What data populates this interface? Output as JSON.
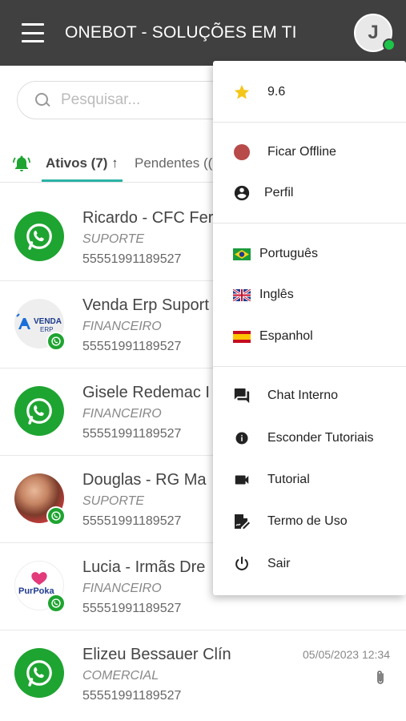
{
  "header": {
    "title": "ONEBOT - SOLUÇÕES EM TI",
    "avatar_initial": "J"
  },
  "search": {
    "placeholder": "Pesquisar..."
  },
  "tabs": {
    "active_label": "Ativos (7) ↑",
    "pending_label": "Pendentes (("
  },
  "chats": [
    {
      "name": "Ricardo - CFC Fer",
      "department": "SUPORTE",
      "phone": "55551991189527",
      "avatar": "whatsapp"
    },
    {
      "name": "Venda Erp Suport",
      "department": "FINANCEIRO",
      "phone": "55551991189527",
      "avatar": "venda-erp"
    },
    {
      "name": "Gisele Redemac I",
      "department": "FINANCEIRO",
      "phone": "55551991189527",
      "avatar": "whatsapp"
    },
    {
      "name": "Douglas - RG Ma",
      "department": "SUPORTE",
      "phone": "55551991189527",
      "avatar": "photo"
    },
    {
      "name": "Lucia - Irmãs Dre",
      "department": "FINANCEIRO",
      "phone": "55551991189527",
      "avatar": "purpoka"
    },
    {
      "name": "Elizeu Bessauer Clín",
      "department": "COMERCIAL",
      "phone": "55551991189527",
      "avatar": "whatsapp",
      "date": "05/05/2023 12:34"
    }
  ],
  "logos": {
    "venda_erp_line1": "VENDA",
    "venda_erp_line2": "ERP",
    "purpoka": "PurPoka"
  },
  "menu": {
    "rating": "9.6",
    "go_offline": "Ficar Offline",
    "profile": "Perfil",
    "lang_pt": "Português",
    "lang_en": "Inglês",
    "lang_es": "Espanhol",
    "internal_chat": "Chat Interno",
    "hide_tutorials": "Esconder Tutoriais",
    "tutorial": "Tutorial",
    "terms": "Termo de Uso",
    "logout": "Sair"
  },
  "colors": {
    "appbar": "#404040",
    "whatsapp_green": "#1ea431",
    "online": "#1dc44a",
    "tab_underline": "#2bb3a6",
    "offline_dot": "#b84a4a",
    "star": "#f5c518"
  }
}
